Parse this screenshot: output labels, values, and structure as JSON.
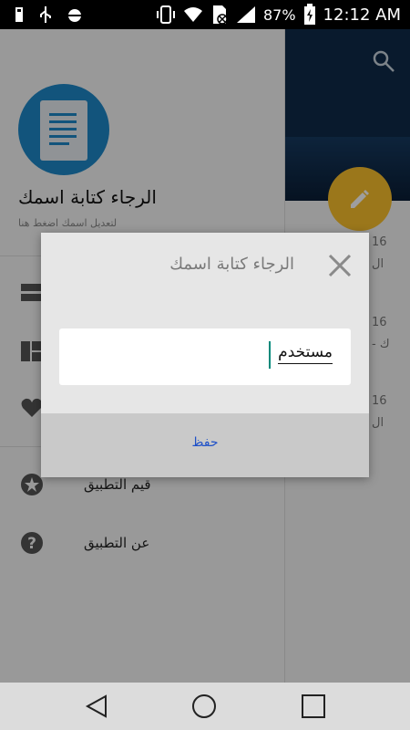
{
  "status_bar": {
    "battery_percent": "87%",
    "time": "12:12 AM",
    "left_icons": [
      "usb-icon",
      "usb-debug-icon",
      "android-icon"
    ],
    "right_icons": [
      "phone-vibrate-icon",
      "wifi-icon",
      "sim-off-icon",
      "signal-icon",
      "battery-charging-icon"
    ]
  },
  "drawer": {
    "user_name": "الرجاء كتابة اسمك",
    "user_hint": "لتعديل اسمك اضغط هنا",
    "menu_items": [
      {
        "icon": "storage-icon",
        "label": ""
      },
      {
        "icon": "dashboard-icon",
        "label": ""
      },
      {
        "icon": "heart-icon",
        "label": ""
      },
      {
        "icon": "star-icon",
        "label": "قيم التطبيق"
      },
      {
        "icon": "help-icon",
        "label": "عن التطبيق"
      }
    ]
  },
  "background_list": {
    "snippets": [
      "16",
      "ال",
      "16",
      "- ك",
      "16",
      "ال"
    ]
  },
  "dialog": {
    "title": "الرجاء كتابة اسمك",
    "input_value": "مستخدم",
    "save_label": "حفظ"
  },
  "colors": {
    "accent": "#1e88c8",
    "fab": "#fbc02d",
    "link": "#1e50c8"
  }
}
